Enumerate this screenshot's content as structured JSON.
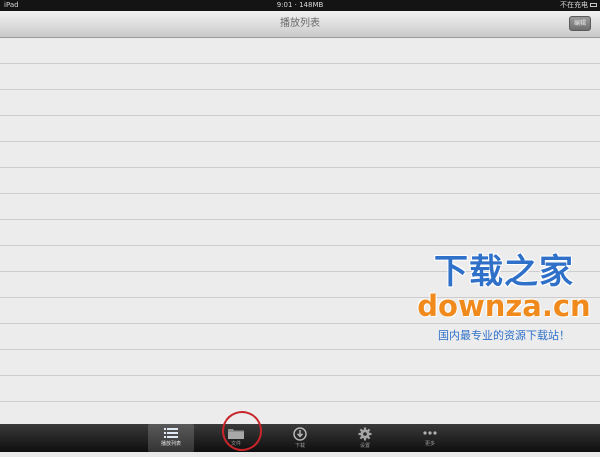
{
  "status_bar": {
    "device": "iPad",
    "time_memory": "9:01 · 148MB",
    "charge_status": "不在充电"
  },
  "nav_bar": {
    "title": "播放列表",
    "edit_label": "编辑"
  },
  "watermark": {
    "line1": "下载之家",
    "line2": "downza.cn",
    "line3": "国内最专业的资源下载站！"
  },
  "tabs": [
    {
      "label": "播放列表",
      "icon": "list-icon",
      "active": true
    },
    {
      "label": "文件",
      "icon": "folder-icon",
      "active": false
    },
    {
      "label": "下载",
      "icon": "download-icon",
      "active": false
    },
    {
      "label": "设置",
      "icon": "gear-icon",
      "active": false
    },
    {
      "label": "更多",
      "icon": "more-icon",
      "active": false
    }
  ],
  "colors": {
    "watermark_blue": "#2f70c9",
    "watermark_orange": "#f08a1c",
    "annotation_red": "#c8252a"
  }
}
